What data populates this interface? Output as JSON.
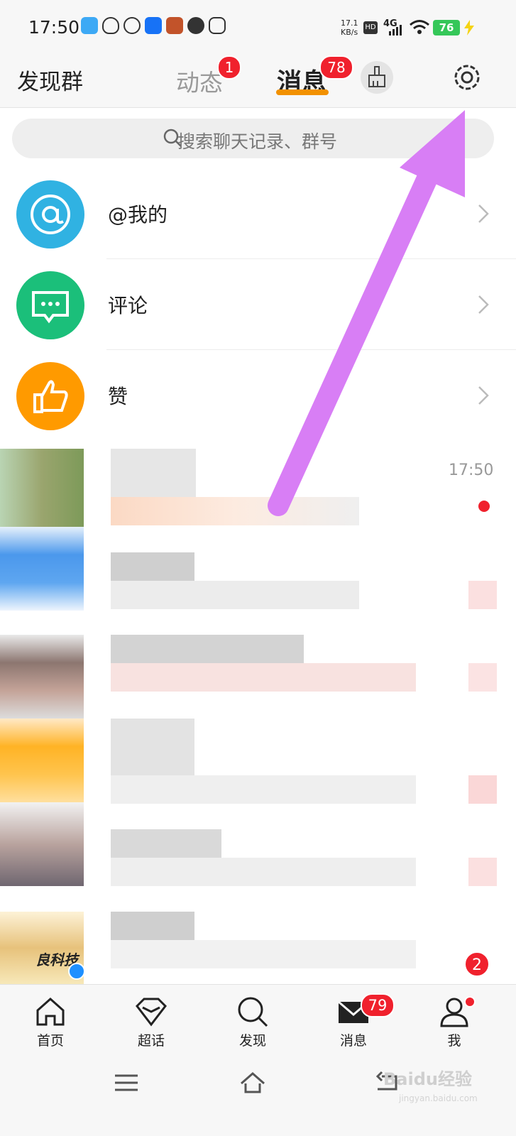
{
  "status_bar": {
    "time": "17:50",
    "net_speed_value": "17.1",
    "net_speed_unit": "KB/s",
    "hd": "HD",
    "network": "4G",
    "battery": "76"
  },
  "header": {
    "left_title": "发现群",
    "tab_dynamic": "动态",
    "tab_dynamic_badge": "1",
    "tab_messages": "消息",
    "tab_messages_badge": "78"
  },
  "search": {
    "placeholder": "搜索聊天记录、群号"
  },
  "notifications": [
    {
      "label": "@我的",
      "icon": "at-icon",
      "color": "#30b2e2"
    },
    {
      "label": "评论",
      "icon": "comment-icon",
      "color": "#1bbf7a"
    },
    {
      "label": "赞",
      "icon": "thumbs-up-icon",
      "color": "#ff9a00"
    }
  ],
  "messages": {
    "first_time": "17:50",
    "brand_fragment": "良科技",
    "unread_count": "2"
  },
  "bottom_nav": [
    {
      "label": "首页",
      "icon": "home-icon"
    },
    {
      "label": "超话",
      "icon": "diamond-icon"
    },
    {
      "label": "发现",
      "icon": "search-icon"
    },
    {
      "label": "消息",
      "icon": "mail-icon",
      "badge": "79"
    },
    {
      "label": "我",
      "icon": "person-icon"
    }
  ],
  "watermark": {
    "text": "Baidu经验",
    "sub": "jingyan.baidu.com"
  },
  "colors": {
    "accent": "#f29100",
    "badge": "#f0212d",
    "arrow": "#d87ef5"
  }
}
